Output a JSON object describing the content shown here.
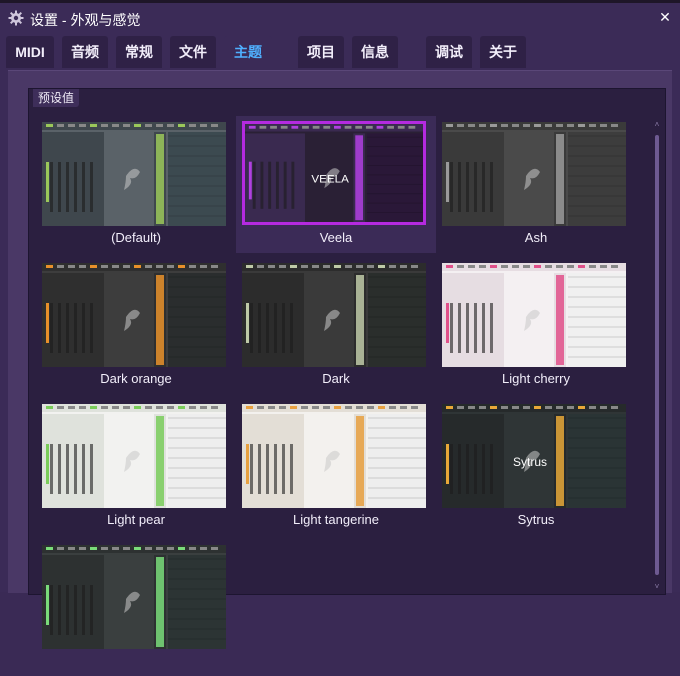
{
  "window": {
    "title": "设置 - 外观与感觉",
    "title_icon": "gear-icon",
    "close_icon": "close-icon",
    "close_glyph": "✕"
  },
  "tabs": [
    {
      "label": "MIDI",
      "active": false
    },
    {
      "label": "音频",
      "active": false
    },
    {
      "label": "常规",
      "active": false
    },
    {
      "label": "文件",
      "active": false
    },
    {
      "label": "主题",
      "active": true
    },
    {
      "label": "项目",
      "active": false
    },
    {
      "label": "信息",
      "active": false
    },
    {
      "label": "调试",
      "active": false
    },
    {
      "label": "关于",
      "active": false
    }
  ],
  "presets": {
    "group_label": "预设值",
    "themes": [
      {
        "label": "(Default)",
        "selected": false,
        "bg": "#5a6268",
        "panel": "#3f474d",
        "accent": "#9bc85a",
        "keys": "#3c4a50",
        "overlay": ""
      },
      {
        "label": "Veela",
        "selected": true,
        "bg": "#2a2035",
        "panel": "#3a2a50",
        "accent": "#b040e0",
        "keys": "#2a1838",
        "overlay": "VEELA"
      },
      {
        "label": "Ash",
        "selected": false,
        "bg": "#4a4a4a",
        "panel": "#3a3a3a",
        "accent": "#9a9a9a",
        "keys": "#3d3d3d",
        "overlay": ""
      },
      {
        "label": "Dark orange",
        "selected": false,
        "bg": "#3d3d3d",
        "panel": "#2f2f2f",
        "accent": "#e8902a",
        "keys": "#2a2d2e",
        "overlay": ""
      },
      {
        "label": "Dark",
        "selected": false,
        "bg": "#3a3a3a",
        "panel": "#2c2c2c",
        "accent": "#bfcaa8",
        "keys": "#2a2e2c",
        "overlay": ""
      },
      {
        "label": "Light cherry",
        "selected": false,
        "bg": "#f4f0f2",
        "panel": "#e6dde2",
        "accent": "#e0508a",
        "keys": "#f0f0f0",
        "overlay": ""
      },
      {
        "label": "Light pear",
        "selected": false,
        "bg": "#f2f2f0",
        "panel": "#dfe2dc",
        "accent": "#7acc5a",
        "keys": "#eeeeee",
        "overlay": ""
      },
      {
        "label": "Light tangerine",
        "selected": false,
        "bg": "#f3f1ee",
        "panel": "#e3ded6",
        "accent": "#e8a040",
        "keys": "#eeeeee",
        "overlay": ""
      },
      {
        "label": "Sytrus",
        "selected": false,
        "bg": "#2f3536",
        "panel": "#262a2b",
        "accent": "#e8a838",
        "keys": "#2a3435",
        "overlay": "Sytrus"
      },
      {
        "label": "",
        "selected": false,
        "bg": "#3a3f3f",
        "panel": "#2d3131",
        "accent": "#7adc7a",
        "keys": "#2c3434",
        "overlay": ""
      }
    ]
  },
  "icons": {
    "scroll_up": "scroll-up-icon",
    "scroll_down": "scroll-down-icon",
    "scroll_up_glyph": "˄",
    "scroll_down_glyph": "˅"
  }
}
